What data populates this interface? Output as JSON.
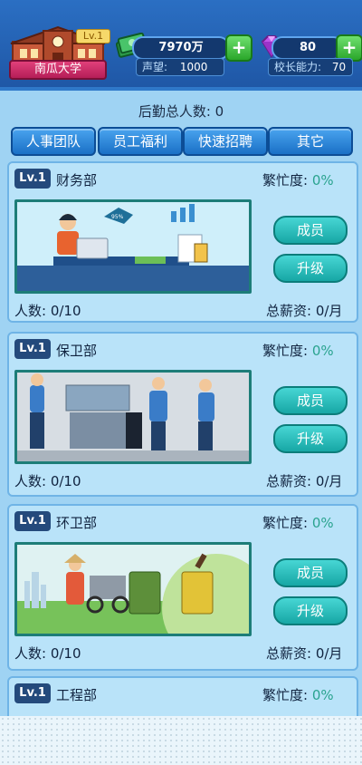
{
  "school": {
    "name": "南瓜大学",
    "level": "Lv.1"
  },
  "resources": {
    "money": "7970万",
    "gems": "80"
  },
  "stats": {
    "reputation_label": "声望:",
    "reputation_value": "1000",
    "ability_label": "校长能力:",
    "ability_value": "70"
  },
  "header": {
    "logistics_total": "后勤总人数: 0"
  },
  "tabs": [
    "人事团队",
    "员工福利",
    "快速招聘",
    "其它"
  ],
  "departments": [
    {
      "level": "Lv.1",
      "name": "财务部",
      "busy_label": "繁忙度:",
      "busy_value": "0%",
      "people": "人数: 0/10",
      "salary": "总薪资: 0/月",
      "member_btn": "成员",
      "upgrade_btn": "升级",
      "scene_text": "95%"
    },
    {
      "level": "Lv.1",
      "name": "保卫部",
      "busy_label": "繁忙度:",
      "busy_value": "0%",
      "people": "人数: 0/10",
      "salary": "总薪资: 0/月",
      "member_btn": "成员",
      "upgrade_btn": "升级"
    },
    {
      "level": "Lv.1",
      "name": "环卫部",
      "busy_label": "繁忙度:",
      "busy_value": "0%",
      "people": "人数: 0/10",
      "salary": "总薪资: 0/月",
      "member_btn": "成员",
      "upgrade_btn": "升级"
    },
    {
      "level": "Lv.1",
      "name": "工程部",
      "busy_label": "繁忙度:",
      "busy_value": "0%"
    }
  ],
  "colors": {
    "topbar": "#2b6fc3",
    "panel": "#9fd3f3",
    "teal_button": "#1fb3b1",
    "busy_value": "#2aa38f"
  }
}
